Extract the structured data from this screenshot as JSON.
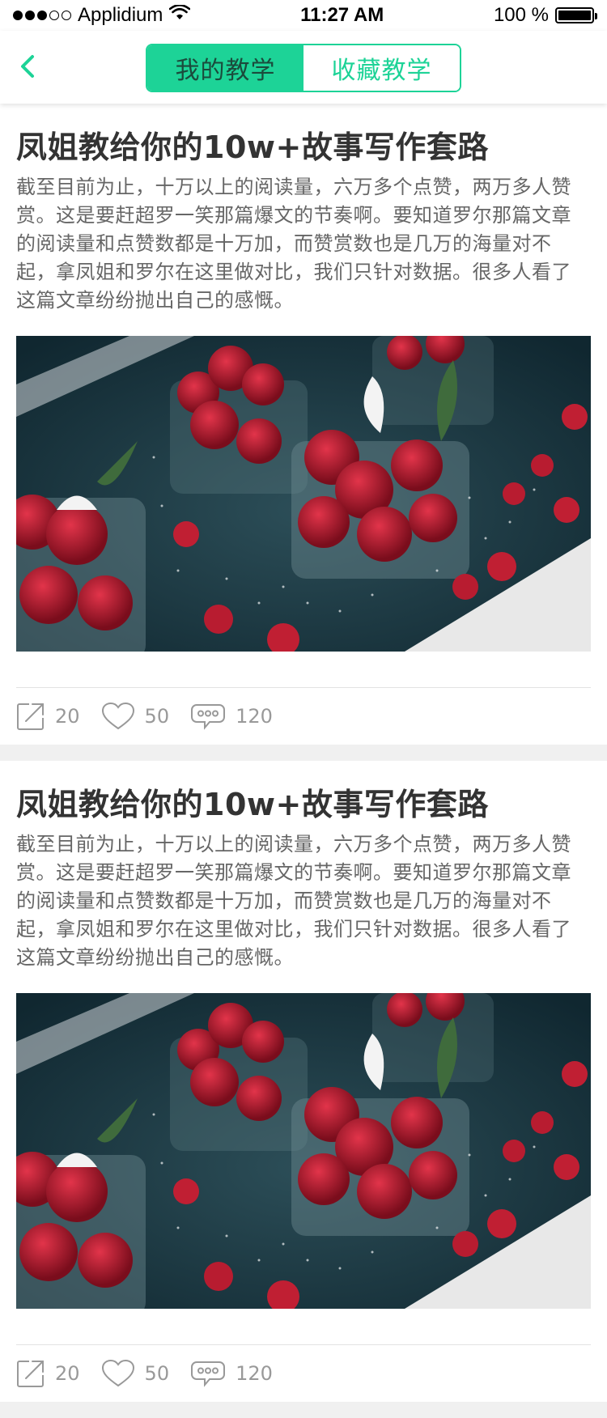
{
  "status_bar": {
    "carrier": "Applidium",
    "time": "11:27 AM",
    "battery": "100 %",
    "signal_filled": 3,
    "signal_total": 5
  },
  "nav": {
    "back_icon": "chevron-left-icon",
    "tabs": [
      {
        "label": "我的教学",
        "active": true
      },
      {
        "label": "收藏教学",
        "active": false
      }
    ],
    "accent_color": "#1dd397"
  },
  "posts": [
    {
      "title": "凤姐教给你的10w+故事写作套路",
      "body": "截至目前为止，十万以上的阅读量，六万多个点赞，两万多人赞赏。这是要赶超罗一笑那篇爆文的节奏啊。要知道罗尔那篇文章的阅读量和点赞数都是十万加，而赞赏数也是几万的海量对不起，拿凤姐和罗尔在这里做对比，我们只针对数据。很多人看了这篇文章纷纷抛出自己的感慨。",
      "image": "strawberries-in-jars",
      "shares": "20",
      "likes": "50",
      "comments": "120"
    },
    {
      "title": "凤姐教给你的10w+故事写作套路",
      "body": "截至目前为止，十万以上的阅读量，六万多个点赞，两万多人赞赏。这是要赶超罗一笑那篇爆文的节奏啊。要知道罗尔那篇文章的阅读量和点赞数都是十万加，而赞赏数也是几万的海量对不起，拿凤姐和罗尔在这里做对比，我们只针对数据。很多人看了这篇文章纷纷抛出自己的感慨。",
      "image": "strawberries-in-jars",
      "shares": "20",
      "likes": "50",
      "comments": "120"
    }
  ]
}
